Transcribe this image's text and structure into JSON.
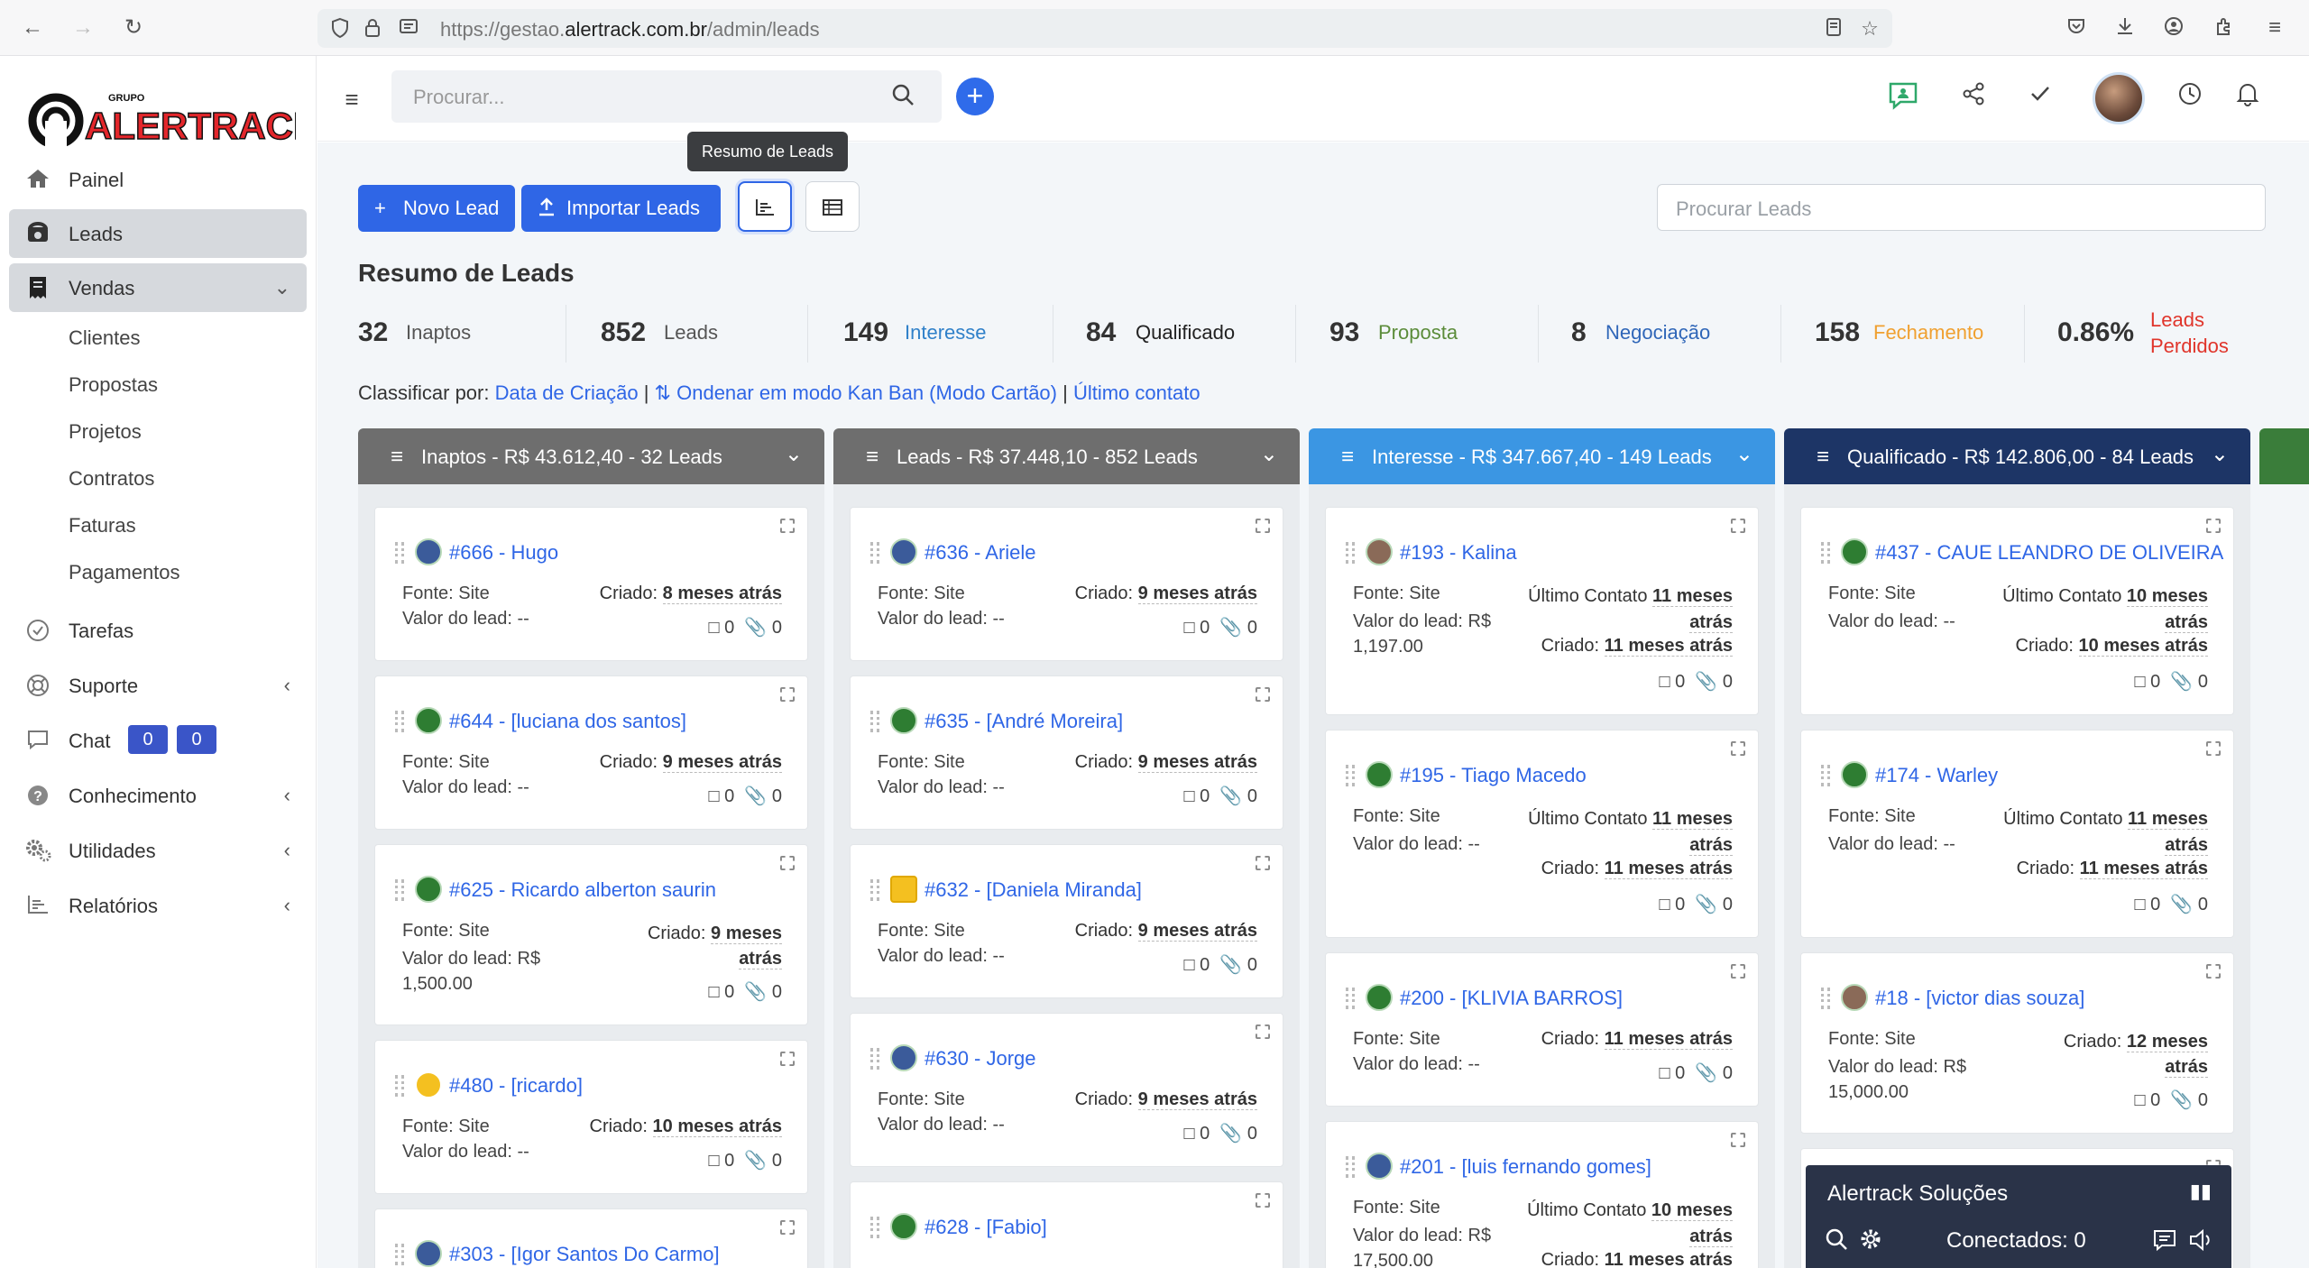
{
  "browser": {
    "url_prefix": "https://gestao.",
    "url_domain": "alertrack.com.br",
    "url_path": "/admin/leads"
  },
  "sidebar": {
    "brand_small": "GRUPO",
    "brand": "ALERTRACK",
    "items": [
      {
        "label": "Painel",
        "icon": "home-icon"
      },
      {
        "label": "Leads",
        "icon": "phone-icon"
      },
      {
        "label": "Vendas",
        "icon": "receipt-icon"
      },
      {
        "label": "Tarefas",
        "icon": "check-circle-icon"
      },
      {
        "label": "Suporte",
        "icon": "lifebuoy-icon"
      },
      {
        "label": "Chat",
        "icon": "chat-icon"
      },
      {
        "label": "Conhecimento",
        "icon": "question-icon"
      },
      {
        "label": "Utilidades",
        "icon": "cogs-icon"
      },
      {
        "label": "Relatórios",
        "icon": "chart-icon"
      }
    ],
    "vendas_sub": [
      "Clientes",
      "Propostas",
      "Projetos",
      "Contratos",
      "Faturas",
      "Pagamentos"
    ],
    "chat_badges": [
      "0",
      "0"
    ]
  },
  "topbar": {
    "search_placeholder": "Procurar..."
  },
  "toolbar": {
    "tooltip": "Resumo de Leads",
    "new_lead": "Novo Lead",
    "import_leads": "Importar Leads",
    "search_placeholder": "Procurar Leads"
  },
  "summary": {
    "title": "Resumo de Leads",
    "stats": [
      {
        "n": "32",
        "label": "Inaptos",
        "color": "#555555"
      },
      {
        "n": "852",
        "label": "Leads",
        "color": "#555555"
      },
      {
        "n": "149",
        "label": "Interesse",
        "color": "#2f80c9"
      },
      {
        "n": "84",
        "label": "Qualificado",
        "color": "#222222"
      },
      {
        "n": "93",
        "label": "Proposta",
        "color": "#5b8c3a"
      },
      {
        "n": "8",
        "label": "Negociação",
        "color": "#2f66b8"
      },
      {
        "n": "158",
        "label": "Fechamento",
        "color": "#f0a030"
      },
      {
        "n": "0.86%",
        "label": "Leads Perdidos",
        "color": "#e0352b"
      }
    ]
  },
  "sort": {
    "prefix": "Classificar por:",
    "opt1": "Data de Criação",
    "opt2": "Ondenar em modo Kan Ban (Modo Cartão)",
    "opt3": "Último contato"
  },
  "columns": [
    {
      "title": "Inaptos - R$ 43.612,40 - 32 Leads",
      "color": "#6e6e6e"
    },
    {
      "title": "Leads - R$ 37.448,10 - 852 Leads",
      "color": "#6e6e6e"
    },
    {
      "title": "Interesse - R$ 347.667,40 - 149 Leads",
      "color": "#3b96e3"
    },
    {
      "title": "Qualificado - R$ 142.806,00 - 84 Leads",
      "color": "#1d3566"
    }
  ],
  "labels": {
    "fonte": "Fonte: Site",
    "valor": "Valor do lead:",
    "criado": "Criado:",
    "ultimo": "Último Contato",
    "zero": "0"
  },
  "cards": {
    "c1": [
      {
        "title": "#666 - Hugo",
        "valor": "--",
        "criado": "8 meses atrás"
      },
      {
        "title": "#644 - [luciana dos santos]",
        "valor": "--",
        "criado": "9 meses atrás"
      },
      {
        "title": "#625 - Ricardo alberton saurin",
        "valor": "R$ 1,500.00",
        "criado": "9 meses atrás"
      },
      {
        "title": "#480 - [ricardo]",
        "valor": "--",
        "criado": "10 meses atrás"
      },
      {
        "title": "#303 - [Igor Santos Do Carmo]"
      }
    ],
    "c2": [
      {
        "title": "#636 - Ariele",
        "valor": "--",
        "criado": "9 meses atrás"
      },
      {
        "title": "#635 - [André Moreira]",
        "valor": "--",
        "criado": "9 meses atrás"
      },
      {
        "title": "#632 - [Daniela Miranda]",
        "valor": "--",
        "criado": "9 meses atrás"
      },
      {
        "title": "#630 - Jorge",
        "valor": "--",
        "criado": "9 meses atrás"
      },
      {
        "title": "#628 - [Fabio]"
      }
    ],
    "c3": [
      {
        "title": "#193 - Kalina",
        "valor": "R$ 1,197.00",
        "ultimo": "11 meses atrás",
        "criado": "11 meses atrás"
      },
      {
        "title": "#195 - Tiago Macedo",
        "valor": "--",
        "ultimo": "11 meses atrás",
        "criado": "11 meses atrás"
      },
      {
        "title": "#200 - [KLIVIA BARROS]",
        "valor": "--",
        "criado": "11 meses atrás"
      },
      {
        "title": "#201 - [luis fernando gomes]",
        "valor": "R$ 17,500.00",
        "ultimo": "10 meses atrás",
        "criado": "11 meses atrás"
      }
    ],
    "c4": [
      {
        "title": "#437 - CAUE LEANDRO DE OLIVEIRA",
        "valor": "--",
        "ultimo": "10 meses atrás",
        "criado": "10 meses atrás"
      },
      {
        "title": "#174 - Warley",
        "valor": "--",
        "ultimo": "11 meses atrás",
        "criado": "11 meses atrás"
      },
      {
        "title": "#18 - [victor dias souza]",
        "valor": "R$ 15,000.00",
        "criado": "12 meses atrás"
      }
    ]
  },
  "chat_widget": {
    "title": "Alertrack Soluções",
    "status": "Conectados: 0"
  }
}
